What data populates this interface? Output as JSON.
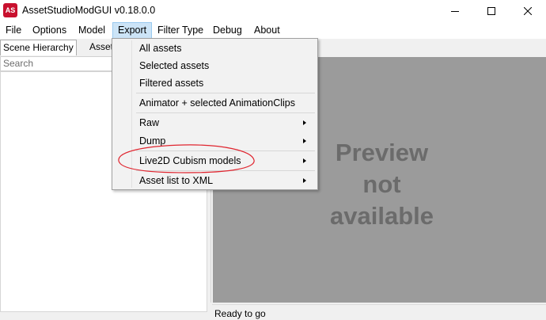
{
  "window": {
    "icon_text": "AS",
    "title": "AssetStudioModGUI v0.18.0.0"
  },
  "menubar": {
    "items": [
      {
        "label": "File"
      },
      {
        "label": "Options"
      },
      {
        "label": "Model"
      },
      {
        "label": "Export"
      },
      {
        "label": "Filter Type"
      },
      {
        "label": "Debug"
      },
      {
        "label": "About"
      }
    ]
  },
  "left_panel": {
    "tabs": [
      {
        "label": "Scene Hierarchy"
      },
      {
        "label": "Asset"
      }
    ],
    "search": {
      "placeholder": "Search"
    }
  },
  "preview": {
    "lines": [
      "Preview",
      "not",
      "available"
    ]
  },
  "status": {
    "text": "Ready to go"
  },
  "export_menu": {
    "items": [
      {
        "label": "All assets"
      },
      {
        "label": "Selected assets"
      },
      {
        "label": "Filtered assets"
      },
      {
        "label": "Animator + selected AnimationClips"
      },
      {
        "label": "Raw"
      },
      {
        "label": "Dump"
      },
      {
        "label": "Live2D Cubism models"
      },
      {
        "label": "Asset list to XML"
      }
    ]
  },
  "colors": {
    "annotation": "#e0252f",
    "menu_highlight": "#cce4f7",
    "preview_bg": "#9b9b9b"
  }
}
